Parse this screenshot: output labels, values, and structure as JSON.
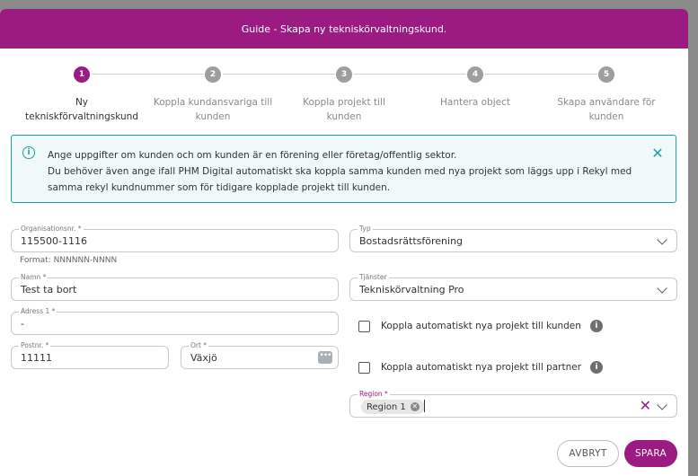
{
  "header": {
    "title": "Guide - Skapa ny tekniskörvaltningskund."
  },
  "steps": [
    {
      "number": "1",
      "label": "Ny tekniskförvaltningskund"
    },
    {
      "number": "2",
      "label": "Koppla kundansvariga till kunden"
    },
    {
      "number": "3",
      "label": "Koppla projekt till kunden"
    },
    {
      "number": "4",
      "label": "Hantera object"
    },
    {
      "number": "5",
      "label": "Skapa användare för kunden"
    }
  ],
  "alert": {
    "icon": "info-icon",
    "line1": "Ange uppgifter om kunden och om kunden är en förening eller företag/offentlig sektor.",
    "line2": "Du behöver även ange ifall PHM Digital automatiskt ska koppla samma kunden med nya projekt som läggs upp i Rekyl med samma rekyl kundnummer som för tidigare kopplade projekt till kunden."
  },
  "form": {
    "org": {
      "label": "Organisationsnr. *",
      "value": "115500-1116",
      "helper": "Format: NNNNNN-NNNN"
    },
    "name": {
      "label": "Namn *",
      "value": "Test ta bort"
    },
    "address": {
      "label": "Adress 1 *",
      "value": "-"
    },
    "postnr": {
      "label": "Postnr. *",
      "value": "11111"
    },
    "ort": {
      "label": "Ort *",
      "value": "Växjö",
      "icon_glyph": "•••"
    },
    "typ": {
      "label": "Typ",
      "value": "Bostadsrättsförening"
    },
    "tjanster": {
      "label": "Tjänster",
      "value": "Tekniskörvaltning Pro"
    },
    "check_customer": {
      "label": "Koppla automatiskt nya projekt till kunden",
      "checked": false
    },
    "check_partner": {
      "label": "Koppla automatiskt nya projekt till partner",
      "checked": false
    },
    "region": {
      "label": "Region *",
      "chip": "Region 1"
    }
  },
  "buttons": {
    "cancel": "AVBRYT",
    "save": "SPARA"
  },
  "colors": {
    "accent": "#9b1b82",
    "info": "#1ea0a5",
    "info_bg": "#f0f9f9"
  }
}
